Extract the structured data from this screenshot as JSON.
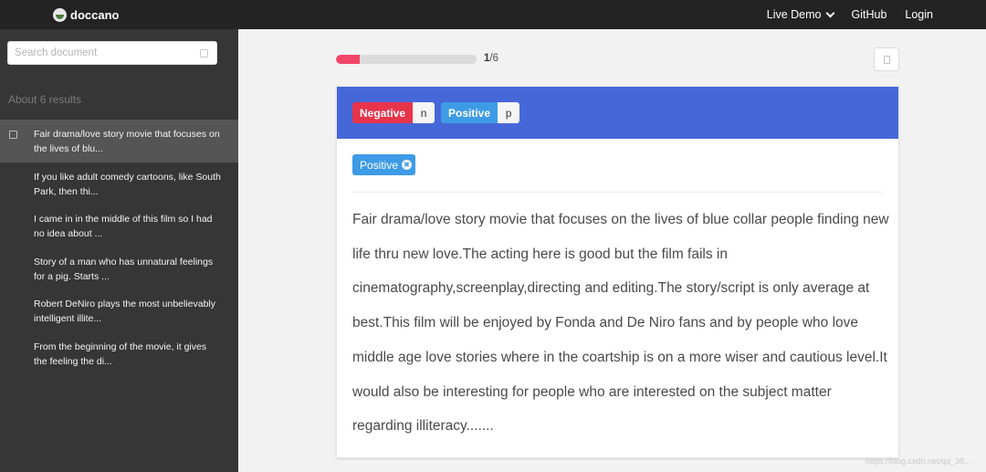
{
  "navbar": {
    "brand": "doccano",
    "links": [
      {
        "label": "Live Demo"
      },
      {
        "label": "GitHub"
      },
      {
        "label": "Login"
      }
    ]
  },
  "sidebar": {
    "search_placeholder": "Search document",
    "results_count": "About 6 results",
    "documents": [
      {
        "text": "Fair drama/love story movie that focuses on the lives of blu...",
        "active": true
      },
      {
        "text": "If you like adult comedy cartoons, like South Park, then thi...",
        "active": false
      },
      {
        "text": "I came in in the middle of this film so I had no idea about ...",
        "active": false
      },
      {
        "text": "Story of a man who has unnatural feelings for a pig. Starts ...",
        "active": false
      },
      {
        "text": "Robert DeNiro plays the most unbelievably intelligent illite...",
        "active": false
      },
      {
        "text": "From the beginning of the movie, it gives the feeling the di...",
        "active": false
      }
    ]
  },
  "progress": {
    "current": "1",
    "total": "/6",
    "fraction": 0.167
  },
  "labels": [
    {
      "name": "Negative",
      "shortcut": "n",
      "color": "#e8344a"
    },
    {
      "name": "Positive",
      "shortcut": "p",
      "color": "#3e9be6"
    }
  ],
  "annotation": {
    "label": "Positive",
    "delete_symbol": "✖"
  },
  "document_text": "Fair drama/love story movie that focuses on the lives of blue collar people finding new life thru new love.The acting here is good but the film fails in cinematography,screenplay,directing and editing.The story/script is only average at best.This film will be enjoyed by Fonda and De Niro fans and by people who love middle age love stories where in the coartship is on a more wiser and cautious level.It would also be interesting for people who are interested on the subject matter regarding illiteracy.......",
  "colors": {
    "navbar": "#232323",
    "sidebar": "#363636",
    "header": "#4667d8",
    "negative": "#e8344a",
    "positive": "#3e9be6",
    "progress": "#f14668"
  },
  "watermark": "https://blog.csdn.net/qq_38..."
}
